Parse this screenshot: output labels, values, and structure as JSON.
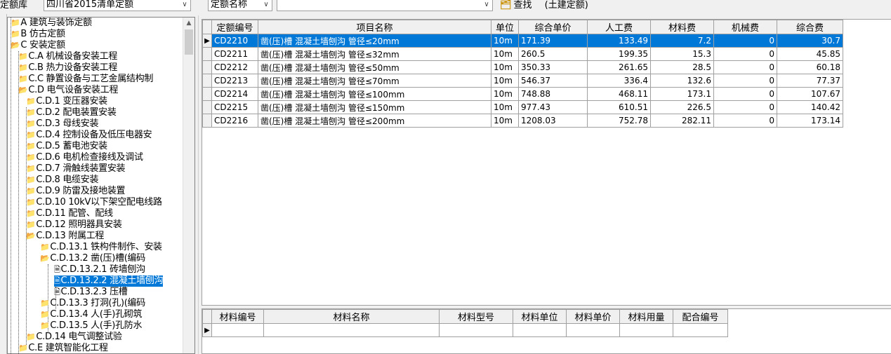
{
  "toolbar": {
    "quota_lib_label": "定额库",
    "quota_lib_value": "四川省2015清单定额",
    "search_field_value": "定额名称",
    "search_input_value": "",
    "find_label": "查找",
    "category_label": "(土建定额)"
  },
  "tree": {
    "nodes": [
      {
        "label": "A 建筑与装饰定额"
      },
      {
        "label": "B 仿古定额"
      },
      {
        "label": "C 安装定额"
      },
      {
        "label": "C.A 机械设备安装工程"
      },
      {
        "label": "C.B 热力设备安装工程"
      },
      {
        "label": "C.C 静置设备与工艺金属结构制"
      },
      {
        "label": "C.D 电气设备安装工程"
      },
      {
        "label": "C.D.1 变压器安装"
      },
      {
        "label": "C.D.2 配电装置安装"
      },
      {
        "label": "C.D.3 母线安装"
      },
      {
        "label": "C.D.4 控制设备及低压电器安"
      },
      {
        "label": "C.D.5 蓄电池安装"
      },
      {
        "label": "C.D.6 电机检查接线及调试"
      },
      {
        "label": "C.D.7 滑触线装置安装"
      },
      {
        "label": "C.D.8 电缆安装"
      },
      {
        "label": "C.D.9 防雷及接地装置"
      },
      {
        "label": "C.D.10 10kV以下架空配电线路"
      },
      {
        "label": "C.D.11 配管、配线"
      },
      {
        "label": "C.D.12 照明器具安装"
      },
      {
        "label": "C.D.13 附属工程"
      },
      {
        "label": "C.D.13.1 铁构件制作、安装"
      },
      {
        "label": "C.D.13.2 凿(压)槽(编码"
      },
      {
        "label": "C.D.13.2.1 砖墙刨沟"
      },
      {
        "label": "C.D.13.2.2 混凝土墙刨沟"
      },
      {
        "label": "C.D.13.2.3 压槽"
      },
      {
        "label": "C.D.13.3 打洞(孔)(编码"
      },
      {
        "label": "C.D.13.4 人(手)孔砌筑"
      },
      {
        "label": "C.D.13.5 人(手)孔防水"
      },
      {
        "label": "C.D.14 电气调整试验"
      },
      {
        "label": "C.E 建筑智能化工程"
      }
    ]
  },
  "quota_table": {
    "headers": [
      "定额编号",
      "项目名称",
      "单位",
      "综合单价",
      "人工费",
      "材料费",
      "机械费",
      "综合费"
    ],
    "rows": [
      {
        "code": "CD2210",
        "name": "凿(压)槽 混凝土墙刨沟 管径≤20mm",
        "unit": "10m",
        "price": "171.39",
        "labor": "133.49",
        "material": "7.2",
        "machine": "0",
        "overhead": "30.7"
      },
      {
        "code": "CD2211",
        "name": "凿(压)槽 混凝土墙刨沟 管径≤32mm",
        "unit": "10m",
        "price": "260.5",
        "labor": "199.35",
        "material": "15.3",
        "machine": "0",
        "overhead": "45.85"
      },
      {
        "code": "CD2212",
        "name": "凿(压)槽 混凝土墙刨沟 管径≤50mm",
        "unit": "10m",
        "price": "350.33",
        "labor": "261.65",
        "material": "28.5",
        "machine": "0",
        "overhead": "60.18"
      },
      {
        "code": "CD2213",
        "name": "凿(压)槽 混凝土墙刨沟 管径≤70mm",
        "unit": "10m",
        "price": "546.37",
        "labor": "336.4",
        "material": "132.6",
        "machine": "0",
        "overhead": "77.37"
      },
      {
        "code": "CD2214",
        "name": "凿(压)槽 混凝土墙刨沟 管径≤100mm",
        "unit": "10m",
        "price": "748.88",
        "labor": "468.11",
        "material": "173.1",
        "machine": "0",
        "overhead": "107.67"
      },
      {
        "code": "CD2215",
        "name": "凿(压)槽 混凝土墙刨沟 管径≤150mm",
        "unit": "10m",
        "price": "977.43",
        "labor": "610.51",
        "material": "226.5",
        "machine": "0",
        "overhead": "140.42"
      },
      {
        "code": "CD2216",
        "name": "凿(压)槽 混凝土墙刨沟 管径≤200mm",
        "unit": "10m",
        "price": "1208.03",
        "labor": "752.78",
        "material": "282.11",
        "machine": "0",
        "overhead": "173.14"
      }
    ]
  },
  "material_table": {
    "headers": [
      "材料编号",
      "材料名称",
      "材料型号",
      "材料单位",
      "材料单价",
      "材料用量",
      "配合编号"
    ]
  }
}
